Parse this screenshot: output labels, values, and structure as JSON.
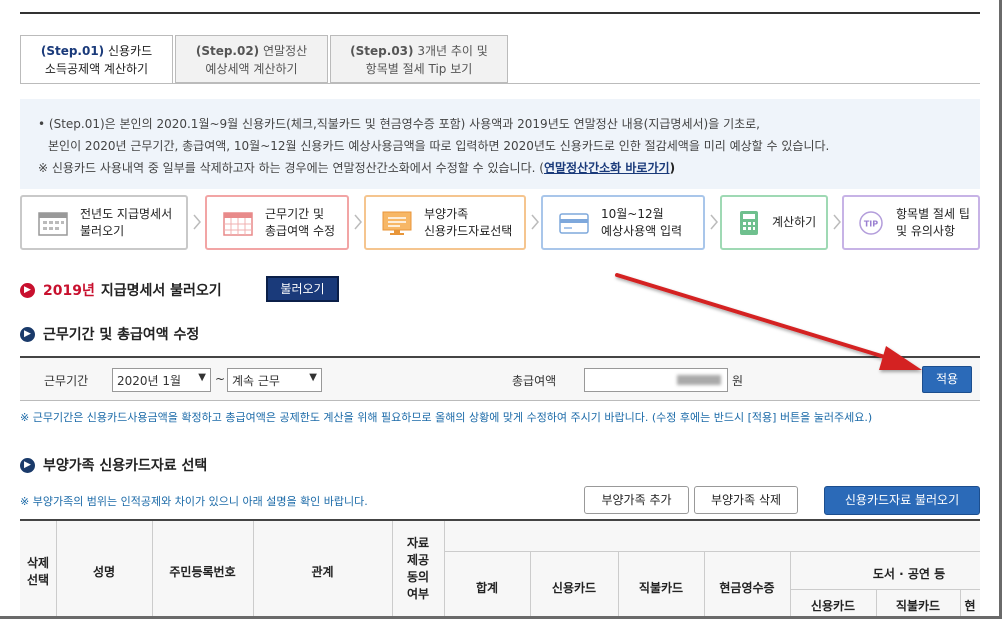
{
  "tabs": [
    {
      "step": "(Step.01)",
      "line1": "신용카드",
      "line2": "소득공제액 계산하기",
      "active": true
    },
    {
      "step": "(Step.02)",
      "line1": "연말정산",
      "line2": "예상세액 계산하기",
      "active": false
    },
    {
      "step": "(Step.03)",
      "line1": "3개년 추이 및",
      "line2": "항목별 절세 Tip 보기",
      "active": false
    }
  ],
  "info": {
    "line1": "• (Step.01)은 본인의 2020.1월~9월 신용카드(체크,직불카드 및 현금영수증 포함) 사용액과 2019년도 연말정산 내용(지급명세서)을 기초로,",
    "line2": "본인이 2020년 근무기간, 총급여액, 10월~12월 신용카드 예상사용금액을 따로 입력하면 2020년도 신용카드로 인한 절감세액을 미리 예상할 수 있습니다.",
    "line3_prefix": "※ 신용카드 사용내역 중 일부를 삭제하고자 하는 경우에는 연말정산간소화에서 수정할 수 있습니다. (",
    "line3_link": "연말정산간소화 바로가기",
    "line3_suffix": ")"
  },
  "steps": [
    {
      "line1": "전년도 지급명세서",
      "line2": "불러오기",
      "icon": "calendar-icon",
      "color": "#bbbbbb"
    },
    {
      "line1": "근무기간 및",
      "line2": "총급여액 수정",
      "icon": "grid-calendar-icon",
      "color": "#f2a5a5"
    },
    {
      "line1": "부양가족",
      "line2": "신용카드자료선택",
      "icon": "monitor-icon",
      "color": "#f5c58f"
    },
    {
      "line1": "10월~12월",
      "line2": "예상사용액 입력",
      "icon": "credit-card-icon",
      "color": "#a9c6ea"
    },
    {
      "line1": "계산하기",
      "line2": "",
      "icon": "calculator-icon",
      "color": "#9fd9b4"
    },
    {
      "line1": "항목별 절세 팁",
      "line2": "및 유의사항",
      "icon": "tip-icon",
      "color": "#c7b3e6"
    }
  ],
  "section1": {
    "year": "2019년",
    "title": "지급명세서 불러오기",
    "button": "불러오기"
  },
  "section2": {
    "title": "근무기간 및 총급여액 수정",
    "period_label": "근무기간",
    "start_value": "2020년 1월",
    "tilde": "~",
    "end_value": "계속 근무",
    "salary_label": "총급여액",
    "salary_unit": "원",
    "apply_button": "적용",
    "note": "※ 근무기간은 신용카드사용금액을 확정하고 총급여액은 공제한도 계산을 위해 필요하므로 올해의 상황에 맞게 수정하여 주시기 바랍니다. (수정 후에는 반드시 [적용] 버튼을 눌러주세요.)"
  },
  "section3": {
    "title": "부양가족 신용카드자료 선택",
    "note": "※ 부양가족의 범위는 인적공제와 차이가 있으니 아래 설명을 확인 바랍니다.",
    "add_button": "부양가족 추가",
    "delete_button": "부양가족 삭제",
    "load_button": "신용카드자료 불러오기"
  },
  "table": {
    "col_delete": [
      "삭제",
      "선택"
    ],
    "col_name": "성명",
    "col_id": "주민등록번호",
    "col_relation": "관계",
    "col_consent": [
      "자료",
      "제공",
      "동의",
      "여부"
    ],
    "col_total": "합계",
    "col_credit": "신용카드",
    "col_debit": "직불카드",
    "col_cash": "현금영수증",
    "group_books": "도서 · 공연 등",
    "sub_credit": "신용카드",
    "sub_debit": "직불카드",
    "sub_cut": "현"
  },
  "colors": {
    "navy": "#1a3a7a",
    "blue": "#2b6ab8",
    "red": "#c8102e",
    "annotation_arrow": "#d42020"
  }
}
